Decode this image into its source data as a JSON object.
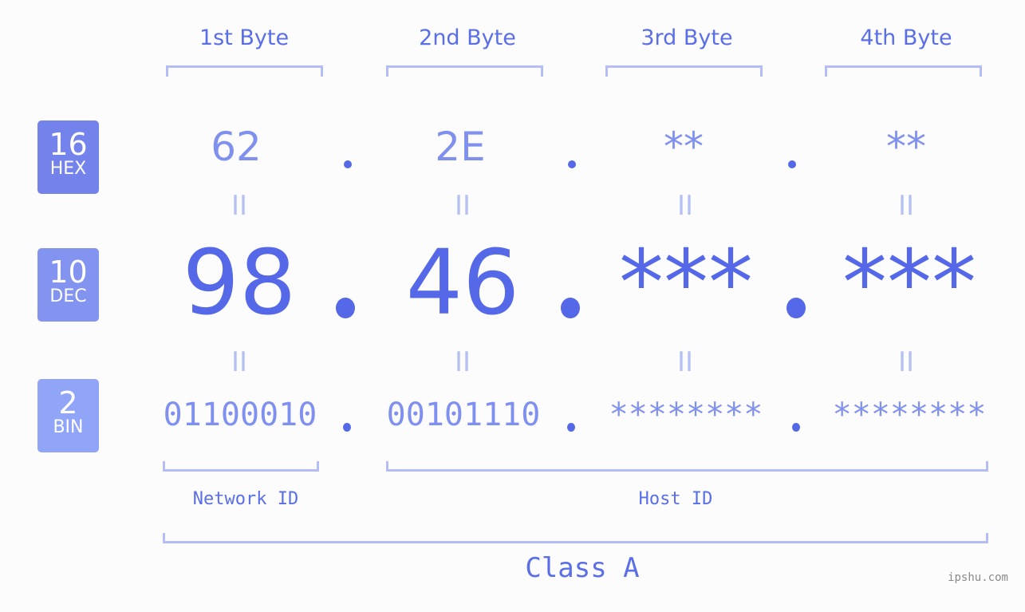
{
  "bytes": [
    {
      "label": "1st Byte",
      "hex": "62",
      "dec": "98",
      "bin": "01100010"
    },
    {
      "label": "2nd Byte",
      "hex": "2E",
      "dec": "46",
      "bin": "00101110"
    },
    {
      "label": "3rd Byte",
      "hex": "**",
      "dec": "***",
      "bin": "********"
    },
    {
      "label": "4th Byte",
      "hex": "**",
      "dec": "***",
      "bin": "********"
    }
  ],
  "badges": {
    "hex": {
      "num": "16",
      "label": "HEX",
      "color": "#7483ec"
    },
    "dec": {
      "num": "10",
      "label": "DEC",
      "color": "#8393f0"
    },
    "bin": {
      "num": "2",
      "label": "BIN",
      "color": "#90a5f7"
    }
  },
  "equals_sign": "II",
  "network_label": "Network ID",
  "host_label": "Host ID",
  "class_label": "Class A",
  "watermark": "ipshu.com",
  "colors": {
    "accent": "#5569e8",
    "light": "#8090ee",
    "bracket": "#b5bdf6"
  }
}
